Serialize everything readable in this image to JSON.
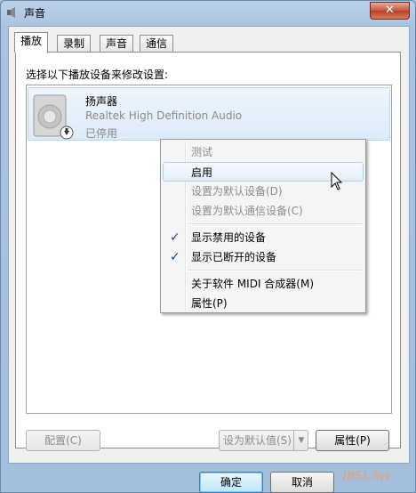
{
  "window": {
    "title": "声音",
    "close_label": "✕"
  },
  "tabs": [
    {
      "label": "播放",
      "active": true
    },
    {
      "label": "录制",
      "active": false
    },
    {
      "label": "声音",
      "active": false
    },
    {
      "label": "通信",
      "active": false
    }
  ],
  "playback": {
    "instruction": "选择以下播放设备来修改设置:",
    "device": {
      "name": "扬声器",
      "driver": "Realtek High Definition Audio",
      "status": "已停用"
    }
  },
  "context_menu": {
    "items": [
      {
        "label": "测试",
        "enabled": false
      },
      {
        "label": "启用",
        "enabled": true,
        "hover": true
      },
      {
        "label": "设置为默认设备(D)",
        "enabled": false
      },
      {
        "label": "设置为默认通信设备(C)",
        "enabled": false
      },
      {
        "label": "显示禁用的设备",
        "enabled": true,
        "checked": true
      },
      {
        "label": "显示已断开的设备",
        "enabled": true,
        "checked": true
      },
      {
        "label": "关于软件 MIDI 合成器(M)",
        "enabled": true
      },
      {
        "label": "属性(P)",
        "enabled": true
      }
    ],
    "check_glyph": "✓"
  },
  "panel_buttons": {
    "configure": "配置(C)",
    "set_default": "设为默认值(S)",
    "set_default_arrow": "▼",
    "properties": "属性(P)"
  },
  "dialog_buttons": {
    "ok": "确定",
    "cancel": "取消"
  },
  "watermark": "JB51.Net",
  "colors": {
    "accent_border": "#3c7fb1",
    "menu_hover": "#aecff7",
    "check": "#1c3fa8",
    "close": "#c6563f"
  }
}
